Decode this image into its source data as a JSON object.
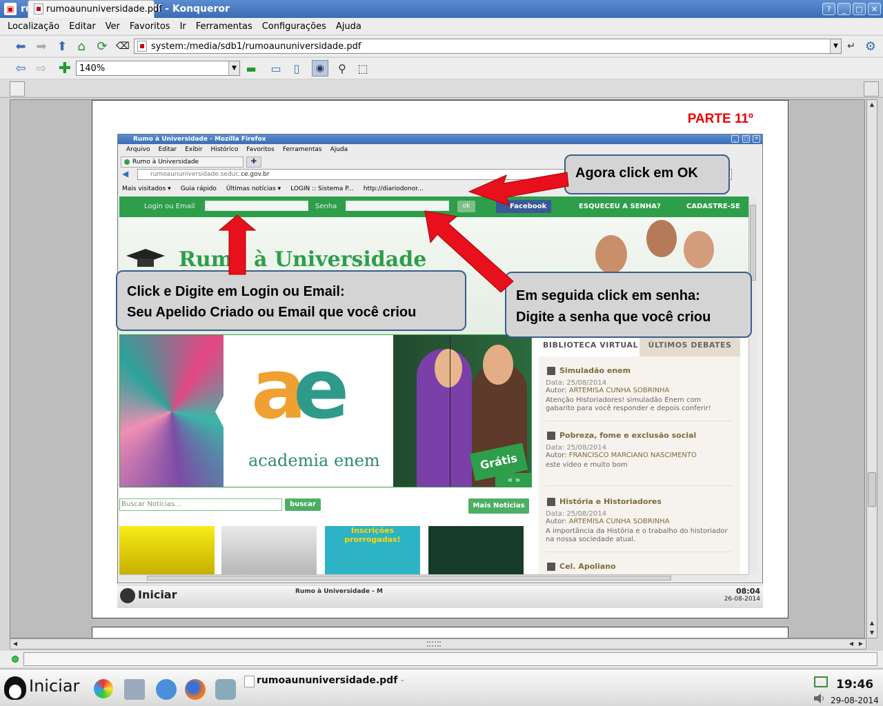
{
  "window": {
    "title": "rumoaununiversidade.pdf - Konqueror",
    "buttons": [
      "?",
      "_",
      "□",
      "✕"
    ]
  },
  "menu": [
    "Localização",
    "Editar",
    "Ver",
    "Favoritos",
    "Ir",
    "Ferramentas",
    "Configurações",
    "Ajuda"
  ],
  "address": {
    "url": "system:/media/sdb1/rumoaununiversidade.pdf"
  },
  "zoom": {
    "value": "140%"
  },
  "tab": {
    "label": "rumoaununiversidade.pdf"
  },
  "pdf": {
    "parte": "PARTE 11º",
    "firefox": {
      "title": "Rumo à Universidade - Mozilla Firefox",
      "menu": [
        "Arquivo",
        "Editar",
        "Exibir",
        "Histórico",
        "Favoritos",
        "Ferramentas",
        "Ajuda"
      ],
      "tab": "Rumo à Universidade",
      "url_host": "rumoaununiversidade.seduc.",
      "url_domain": "ce.gov.br",
      "bookmarks": [
        "Mais visitados ▾",
        "Guia rápido",
        "Últimas notícias ▾",
        "LOGIN :: Sistema P...",
        "http://diariodonor..."
      ],
      "site": {
        "login_label": "Login ou Email",
        "senha_label": "Senha",
        "ok": "ok",
        "facebook": "Facebook",
        "esqueceu": "ESQUECEU A SENHA?",
        "cadastre": "CADASTRE-SE",
        "logo": "Rumo à Universidade",
        "banner_ae_a": "a",
        "banner_ae_e": "e",
        "banner_academia": "academia enem",
        "banner_gratis": "Grátis",
        "banner_nav": "«  »",
        "tab_biblioteca": "BIBLIOTECA VIRTUAL",
        "tab_debates": "ÚLTIMOS DEBATES",
        "articles": [
          {
            "title": "Simuladão enem",
            "date": "Data: 25/08/2014",
            "author_label": "Autor:",
            "author": "ARTEMISA CUNHA SOBRINHA",
            "desc": "Atenção Historiadores! simuladão Enem com gabarito para você responder e depois conferir!"
          },
          {
            "title": "Pobreza, fome e exclusão social",
            "date": "Data: 25/08/2014",
            "author_label": "Autor:",
            "author": "FRANCISCO MARCIANO NASCIMENTO",
            "desc": "este video e muito bom"
          },
          {
            "title": "História e Historiadores",
            "date": "Data: 25/08/2014",
            "author_label": "Autor:",
            "author": "ARTEMISA CUNHA SOBRINHA",
            "desc": "A importância da História e o trabalho do historiador na nossa sociedade atual."
          },
          {
            "title": "Cel. Apoliano",
            "date": "",
            "author_label": "",
            "author": "",
            "desc": ""
          }
        ],
        "search_placeholder": "Buscar Notícias...",
        "search_btn": "buscar",
        "mais_noticias": "Mais Notícias",
        "thumb3": "Inscrições prorrogadas!"
      }
    },
    "inner_taskbar": {
      "start": "Iniciar",
      "item": "Rumo à Universidade - M",
      "time": "08:04",
      "date": "26-08-2014"
    },
    "callouts": {
      "ok": "Agora click em    OK",
      "login_line1": "Click e Digite  em Login ou Email:",
      "login_line2": "Seu Apelido Criado   ou  Email  que você criou",
      "senha_line1": "Em seguida click em senha:",
      "senha_line2": "Digite a senha que você criou"
    }
  },
  "taskbar": {
    "start": "Iniciar",
    "task": "rumoaununiversidade.pdf",
    "task_suffix": " -",
    "time": "19:46",
    "date": "29-08-2014"
  },
  "colors": {
    "titlebar": "#3b6cb5",
    "site_green": "#2e9e4b",
    "parte_red": "#e00000",
    "callout_border": "#385d8a",
    "arrow_red": "#e8101c"
  }
}
